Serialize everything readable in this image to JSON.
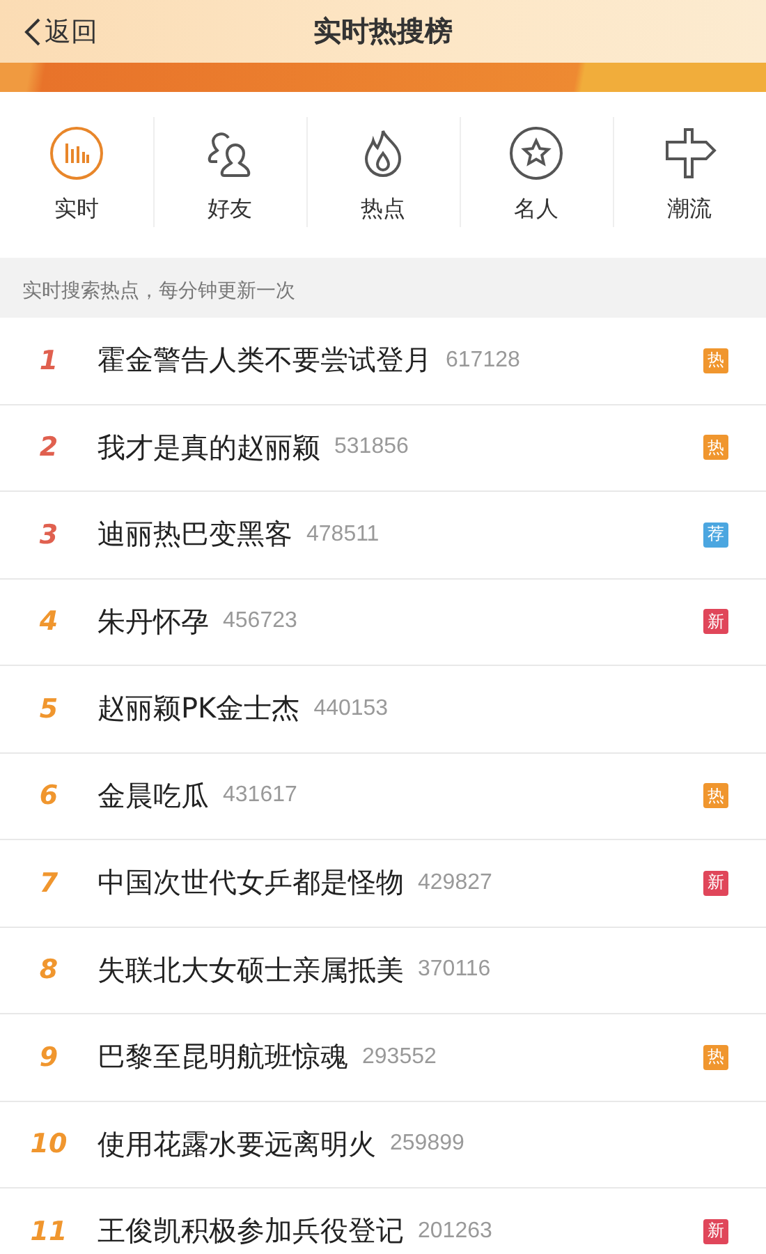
{
  "header": {
    "back": "返回",
    "title": "实时热搜榜"
  },
  "tabs": [
    {
      "label": "实时",
      "selected": true
    },
    {
      "label": "好友",
      "selected": false
    },
    {
      "label": "热点",
      "selected": false
    },
    {
      "label": "名人",
      "selected": false
    },
    {
      "label": "潮流",
      "selected": false
    }
  ],
  "notice": "实时搜索热点，每分钟更新一次",
  "items": [
    {
      "rank": "1",
      "color": "#e0604f",
      "title": "霍金警告人类不要尝试登月",
      "count": "617128",
      "badge": {
        "text": "热",
        "color": "#f0962e"
      }
    },
    {
      "rank": "2",
      "color": "#e0604f",
      "title": "我才是真的赵丽颖",
      "count": "531856",
      "badge": {
        "text": "热",
        "color": "#f0962e"
      }
    },
    {
      "rank": "3",
      "color": "#e0604f",
      "title": "迪丽热巴变黑客",
      "count": "478511",
      "badge": {
        "text": "荐",
        "color": "#4ba6e0"
      }
    },
    {
      "rank": "4",
      "color": "#f0962e",
      "title": "朱丹怀孕",
      "count": "456723",
      "badge": {
        "text": "新",
        "color": "#e0465a"
      }
    },
    {
      "rank": "5",
      "color": "#f0962e",
      "title": "赵丽颖PK金士杰",
      "count": "440153"
    },
    {
      "rank": "6",
      "color": "#f0962e",
      "title": "金晨吃瓜",
      "count": "431617",
      "badge": {
        "text": "热",
        "color": "#f0962e"
      }
    },
    {
      "rank": "7",
      "color": "#f0962e",
      "title": "中国次世代女乒都是怪物",
      "count": "429827",
      "badge": {
        "text": "新",
        "color": "#e0465a"
      }
    },
    {
      "rank": "8",
      "color": "#f0962e",
      "title": "失联北大女硕士亲属抵美",
      "count": "370116"
    },
    {
      "rank": "9",
      "color": "#f0962e",
      "title": "巴黎至昆明航班惊魂",
      "count": "293552",
      "badge": {
        "text": "热",
        "color": "#f0962e"
      }
    },
    {
      "rank": "10",
      "color": "#f0962e",
      "title": "使用花露水要远离明火",
      "count": "259899"
    },
    {
      "rank": "11",
      "color": "#f0962e",
      "title": "王俊凯积极参加兵役登记",
      "count": "201263",
      "badge": {
        "text": "新",
        "color": "#e0465a"
      }
    }
  ]
}
